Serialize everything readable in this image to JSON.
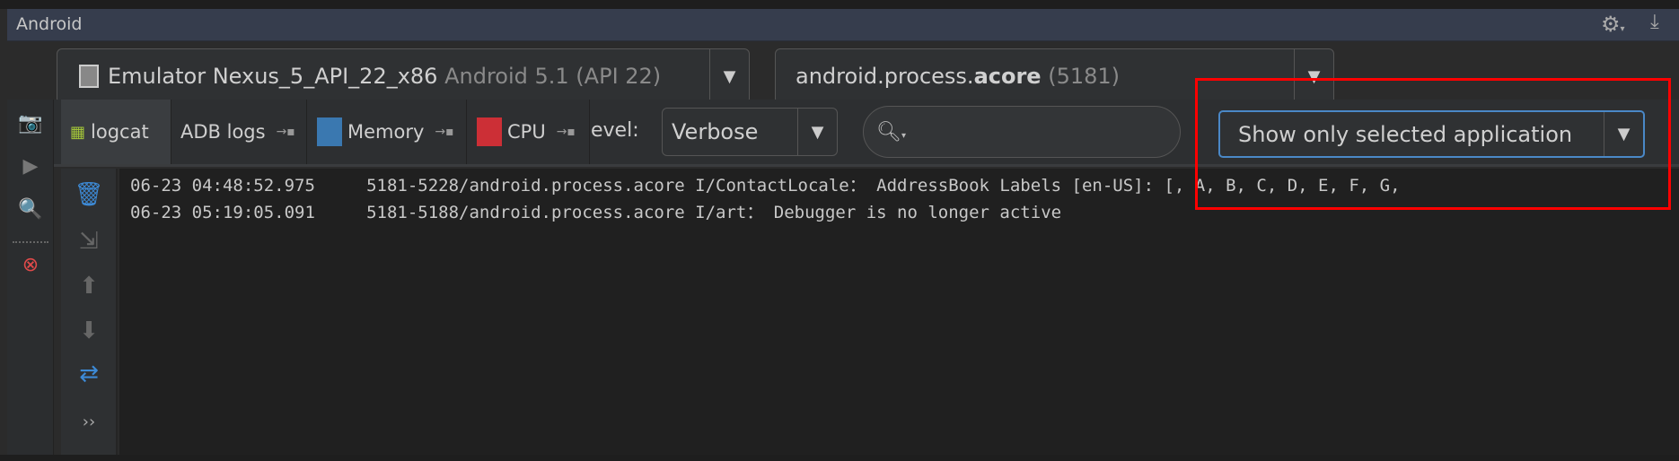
{
  "window": {
    "title": "Android",
    "icons": [
      "gear-icon",
      "hide-panel-icon"
    ]
  },
  "device_combo": {
    "name": "Emulator Nexus_5_API_22_x86",
    "version": "Android 5.1 (API 22)"
  },
  "process_combo": {
    "prefix": "android.process.",
    "bold": "acore",
    "pid": "(5181)"
  },
  "tabs": [
    {
      "label": "logcat"
    },
    {
      "label": "ADB logs"
    },
    {
      "label": "Memory"
    },
    {
      "label": "CPU"
    }
  ],
  "level": {
    "label": "evel:",
    "value": "Verbose"
  },
  "search": {
    "value": ""
  },
  "filter_combo": {
    "value": "Show only selected application"
  },
  "log_lines": [
    "06-23 04:48:52.975     5181-5228/android.process.acore I/ContactLocale： AddressBook Labels [en-US]: [, A, B, C, D, E, F, G,",
    "06-23 05:19:05.091     5181-5188/android.process.acore I/art： Debugger is no longer active"
  ],
  "more": "››",
  "colors": {
    "highlight": "#ff0000",
    "focus": "#4a88c7",
    "title_bar": "#363d4d"
  }
}
